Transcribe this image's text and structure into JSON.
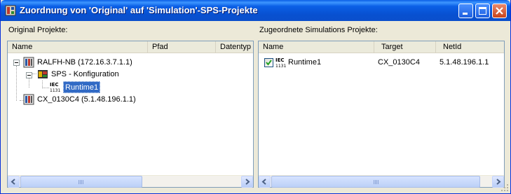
{
  "window": {
    "title": "Zuordnung von 'Original' auf 'Simulation'-SPS-Projekte"
  },
  "left": {
    "label": "Original Projekte:",
    "columns": [
      "Name",
      "Pfad",
      "Datentyp"
    ],
    "tree": [
      {
        "label": "RALFH-NB (172.16.3.7.1.1)",
        "icon": "plc-device-icon",
        "expanded": true
      },
      {
        "label": "SPS - Konfiguration",
        "icon": "plc-config-icon",
        "expanded": true
      },
      {
        "label": "Runtime1",
        "icon": "iec-1131-icon",
        "selected": true
      },
      {
        "label": "CX_0130C4 (5.1.48.196.1.1)",
        "icon": "plc-device-icon"
      }
    ]
  },
  "right": {
    "label": "Zugeordnete Simulations Projekte:",
    "columns": [
      "Name",
      "Target",
      "NetId"
    ],
    "rows": [
      {
        "name": "Runtime1",
        "target": "CX_0130C4",
        "netid": "5.1.48.196.1.1",
        "checked": true,
        "icon": "iec-1131-icon"
      }
    ]
  },
  "colors": {
    "titlebar": "#0a5fe6",
    "selection": "#316ac5",
    "window_bg": "#ece9d8"
  }
}
